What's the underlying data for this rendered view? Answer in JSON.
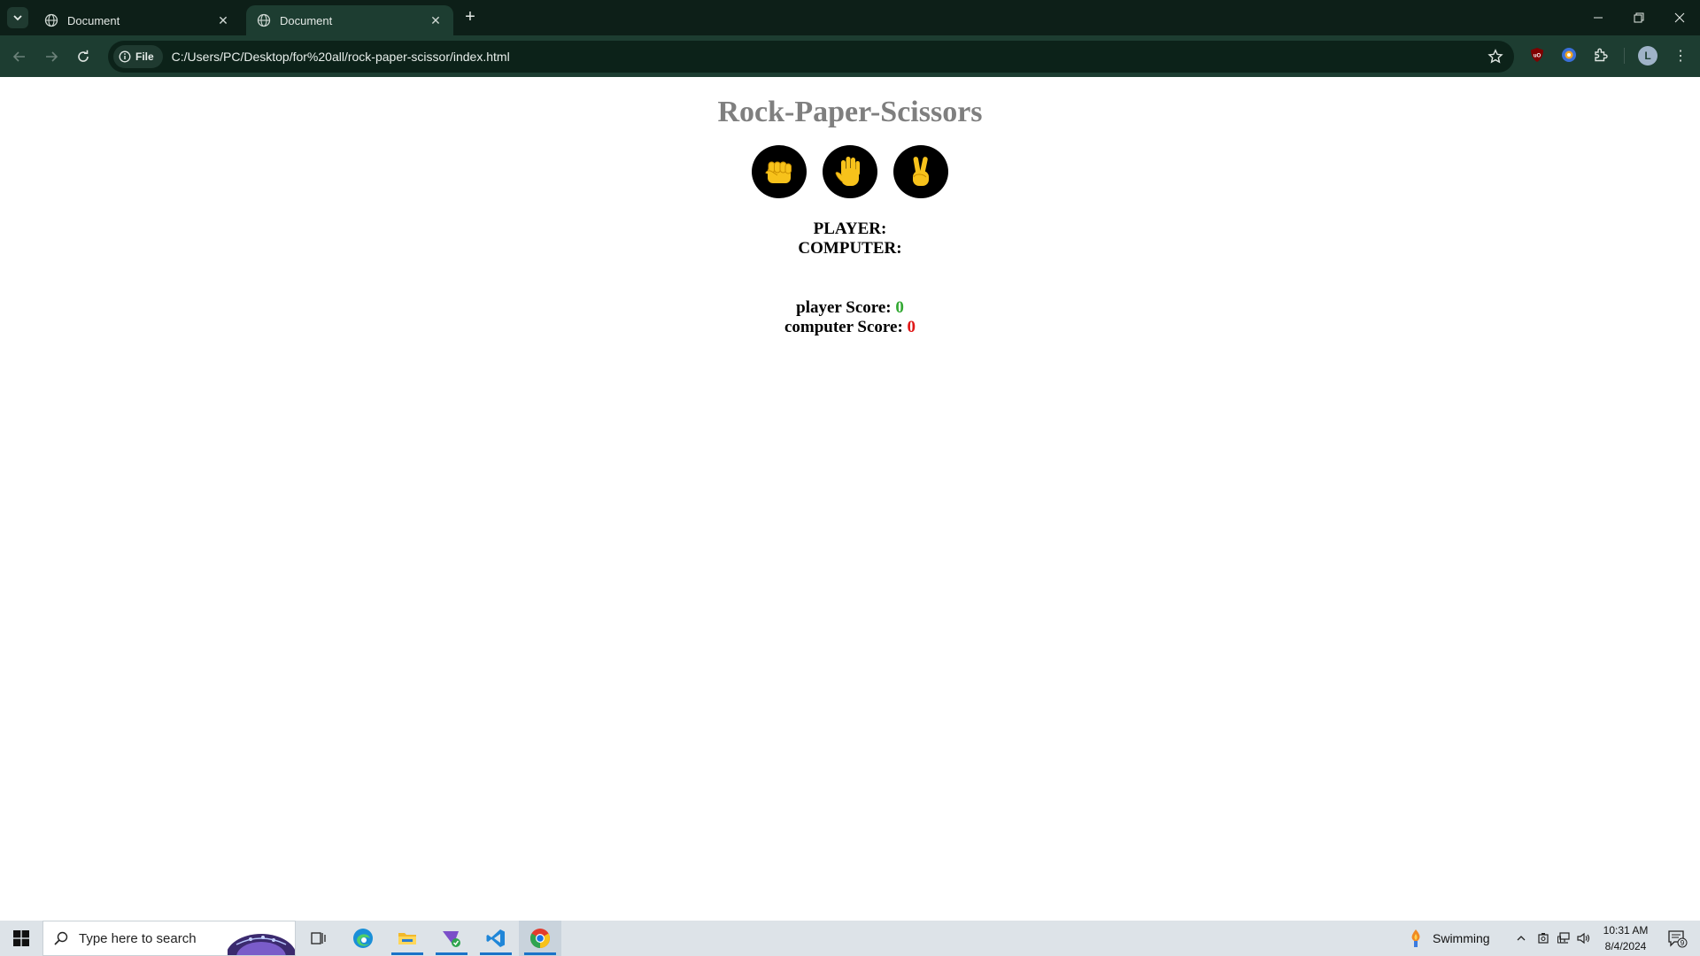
{
  "browser": {
    "tabs": [
      {
        "title": "Document",
        "active": false
      },
      {
        "title": "Document",
        "active": true
      }
    ],
    "address": {
      "scheme_chip": "File",
      "url": "C:/Users/PC/Desktop/for%20all/rock-paper-scissor/index.html"
    },
    "profile_initial": "L"
  },
  "page": {
    "title": "Rock-Paper-Scissors",
    "choices": [
      {
        "name": "rock",
        "emoji": "fist"
      },
      {
        "name": "paper",
        "emoji": "raised-hand"
      },
      {
        "name": "scissors",
        "emoji": "victory-hand"
      }
    ],
    "player_label": "PLAYER:",
    "computer_label": "COMPUTER:",
    "player_score_label": "player Score:",
    "player_score": "0",
    "computer_score_label": "computer Score:",
    "computer_score": "0",
    "colors": {
      "title": "#7f7f7f",
      "player_score": "#33a933",
      "computer_score": "#e01818",
      "choice_bg": "#000000",
      "emoji_yellow": "#f7c21b"
    }
  },
  "taskbar": {
    "search_placeholder": "Type here to search",
    "weather_text": "Swimming",
    "time": "10:31 AM",
    "date": "8/4/2024",
    "notification_count": "9"
  }
}
